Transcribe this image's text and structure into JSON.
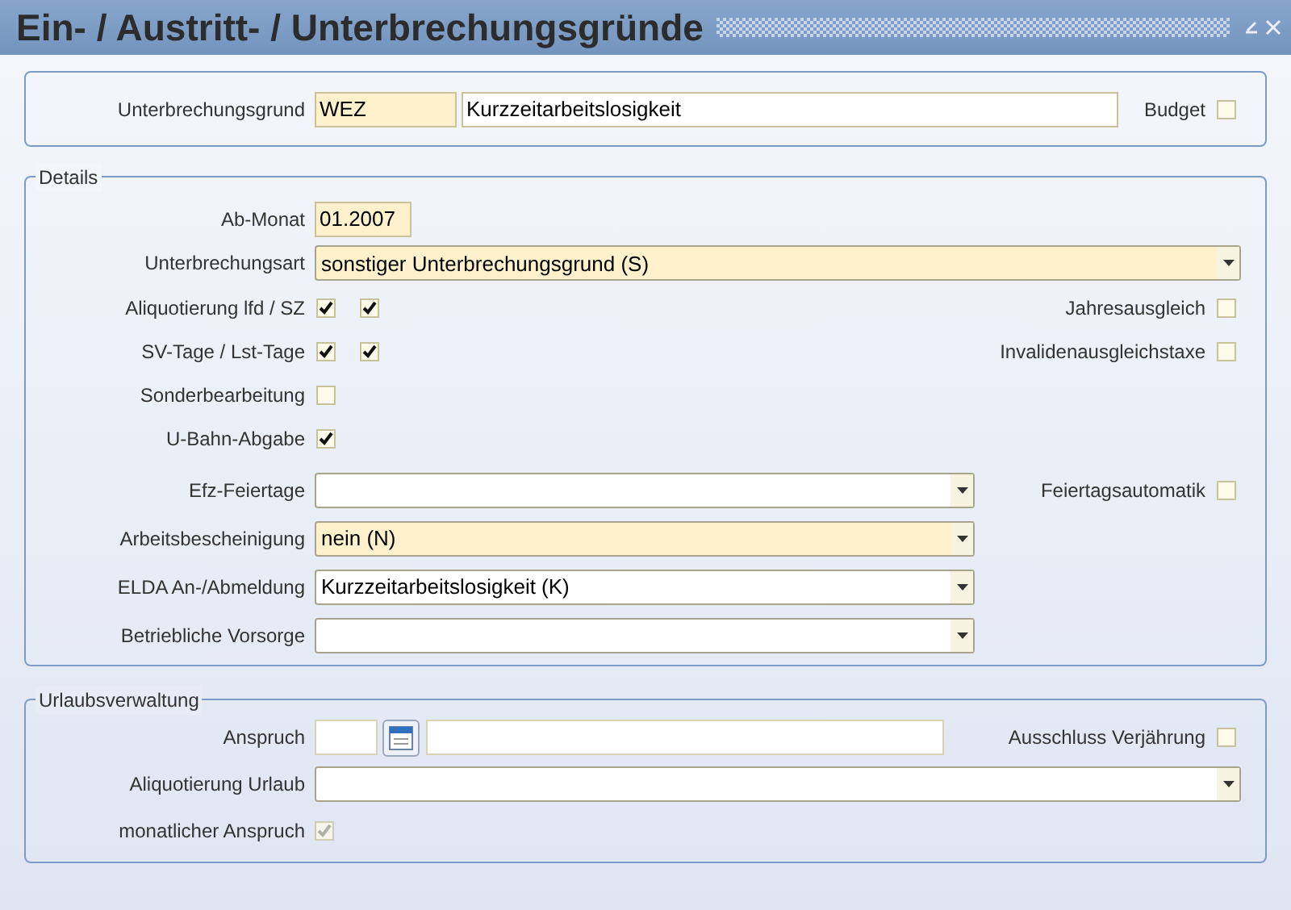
{
  "title": "Ein- / Austritt- / Unterbrechungsgründe",
  "header": {
    "label": "Unterbrechungsgrund",
    "code": {
      "value": "WEZ",
      "required": true
    },
    "name": {
      "value": "Kurzzeitarbeitslosigkeit",
      "required": false
    },
    "budget": {
      "label": "Budget",
      "checked": false
    }
  },
  "details": {
    "legend": "Details",
    "rows": [
      {
        "kind": "text",
        "label": "Ab-Monat",
        "value": "01.2007",
        "required": true
      },
      {
        "kind": "select",
        "label": "Unterbrechungsart",
        "value": "sonstiger Unterbrechungsgrund (S)",
        "required": true
      },
      {
        "kind": "checks",
        "label": "Aliquotierung lfd / SZ",
        "checks": [
          {
            "checked": true
          },
          {
            "checked": true
          }
        ],
        "aside": {
          "label": "Jahresausgleich",
          "checked": false
        }
      },
      {
        "kind": "checks",
        "label": "SV-Tage / Lst-Tage",
        "checks": [
          {
            "checked": true
          },
          {
            "checked": true
          }
        ],
        "aside": {
          "label": "Invalidenausgleichstaxe",
          "checked": false
        }
      },
      {
        "kind": "checks",
        "label": "Sonderbearbeitung",
        "checks": [
          {
            "checked": false
          }
        ]
      },
      {
        "kind": "checks",
        "label": "U-Bahn-Abgabe",
        "checks": [
          {
            "checked": true
          }
        ]
      }
    ],
    "choices": [
      {
        "label": "Efz-Feiertage",
        "required": false,
        "aside": {
          "label": "Feiertagsautomatik",
          "checked": false
        }
      },
      {
        "label": "Arbeitsbescheinigung",
        "value": "nein (N)",
        "required": true
      },
      {
        "label": "ELDA An-/Abmeldung",
        "value": "Kurzzeitarbeitslosigkeit (K)",
        "required": false
      },
      {
        "label": "Betriebliche Vorsorge",
        "required": false
      }
    ]
  },
  "vacation": {
    "legend": "Urlaubsverwaltung",
    "entitlement": {
      "label": "Anspruch",
      "aside": {
        "label": "Ausschluss Verjährung",
        "checked": false
      }
    },
    "proration": {
      "label": "Aliquotierung Urlaub",
      "required": false
    },
    "monthly": {
      "label": "monatlicher Anspruch",
      "checked": true,
      "disabled": true
    }
  }
}
